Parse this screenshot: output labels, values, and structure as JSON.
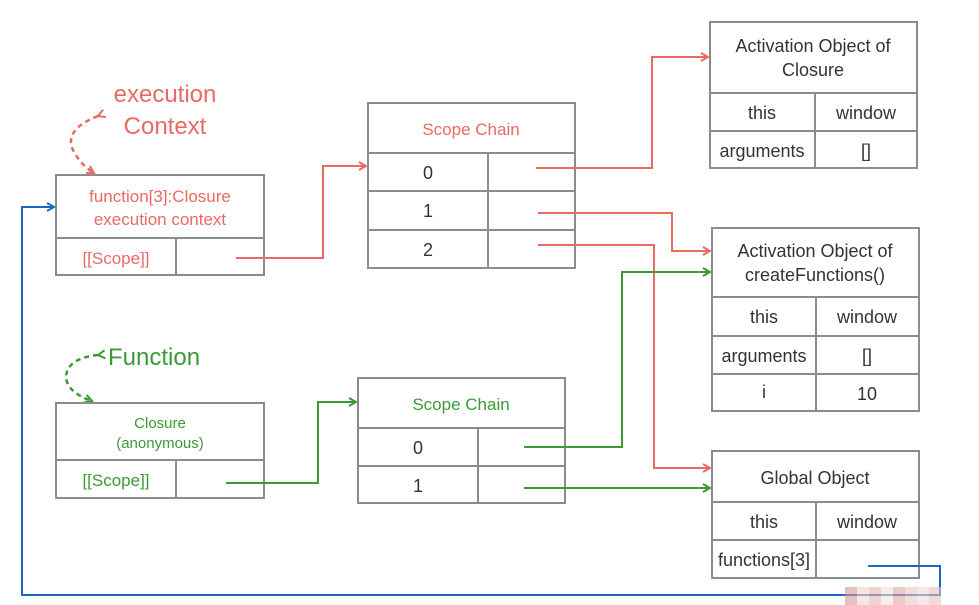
{
  "colors": {
    "red": "#ea6a63",
    "green": "#3c9a36",
    "blue": "#1f66c4",
    "border": "#8a8d90"
  },
  "labels": {
    "execution_context": [
      "execution",
      "Context"
    ],
    "function": "Function"
  },
  "ec_box": {
    "title": [
      "function[3]:Closure",
      "execution context"
    ],
    "scope": "[[Scope]]"
  },
  "closure_box": {
    "title": [
      "Closure",
      "(anonymous)"
    ],
    "scope": "[[Scope]]"
  },
  "scope_chain_1": {
    "title": "Scope Chain",
    "rows": [
      "0",
      "1",
      "2"
    ]
  },
  "scope_chain_2": {
    "title": "Scope Chain",
    "rows": [
      "0",
      "1"
    ]
  },
  "ao_closure": {
    "title": [
      "Activation Object of",
      "Closure"
    ],
    "rows": [
      [
        "this",
        "window"
      ],
      [
        "arguments",
        "[]"
      ]
    ]
  },
  "ao_create": {
    "title": [
      "Activation Object of",
      "createFunctions()"
    ],
    "rows": [
      [
        "this",
        "window"
      ],
      [
        "arguments",
        "[]"
      ],
      [
        "i",
        "10"
      ]
    ]
  },
  "global": {
    "title": "Global Object",
    "rows": [
      [
        "this",
        "window"
      ],
      [
        "functions[3]",
        ""
      ]
    ]
  }
}
